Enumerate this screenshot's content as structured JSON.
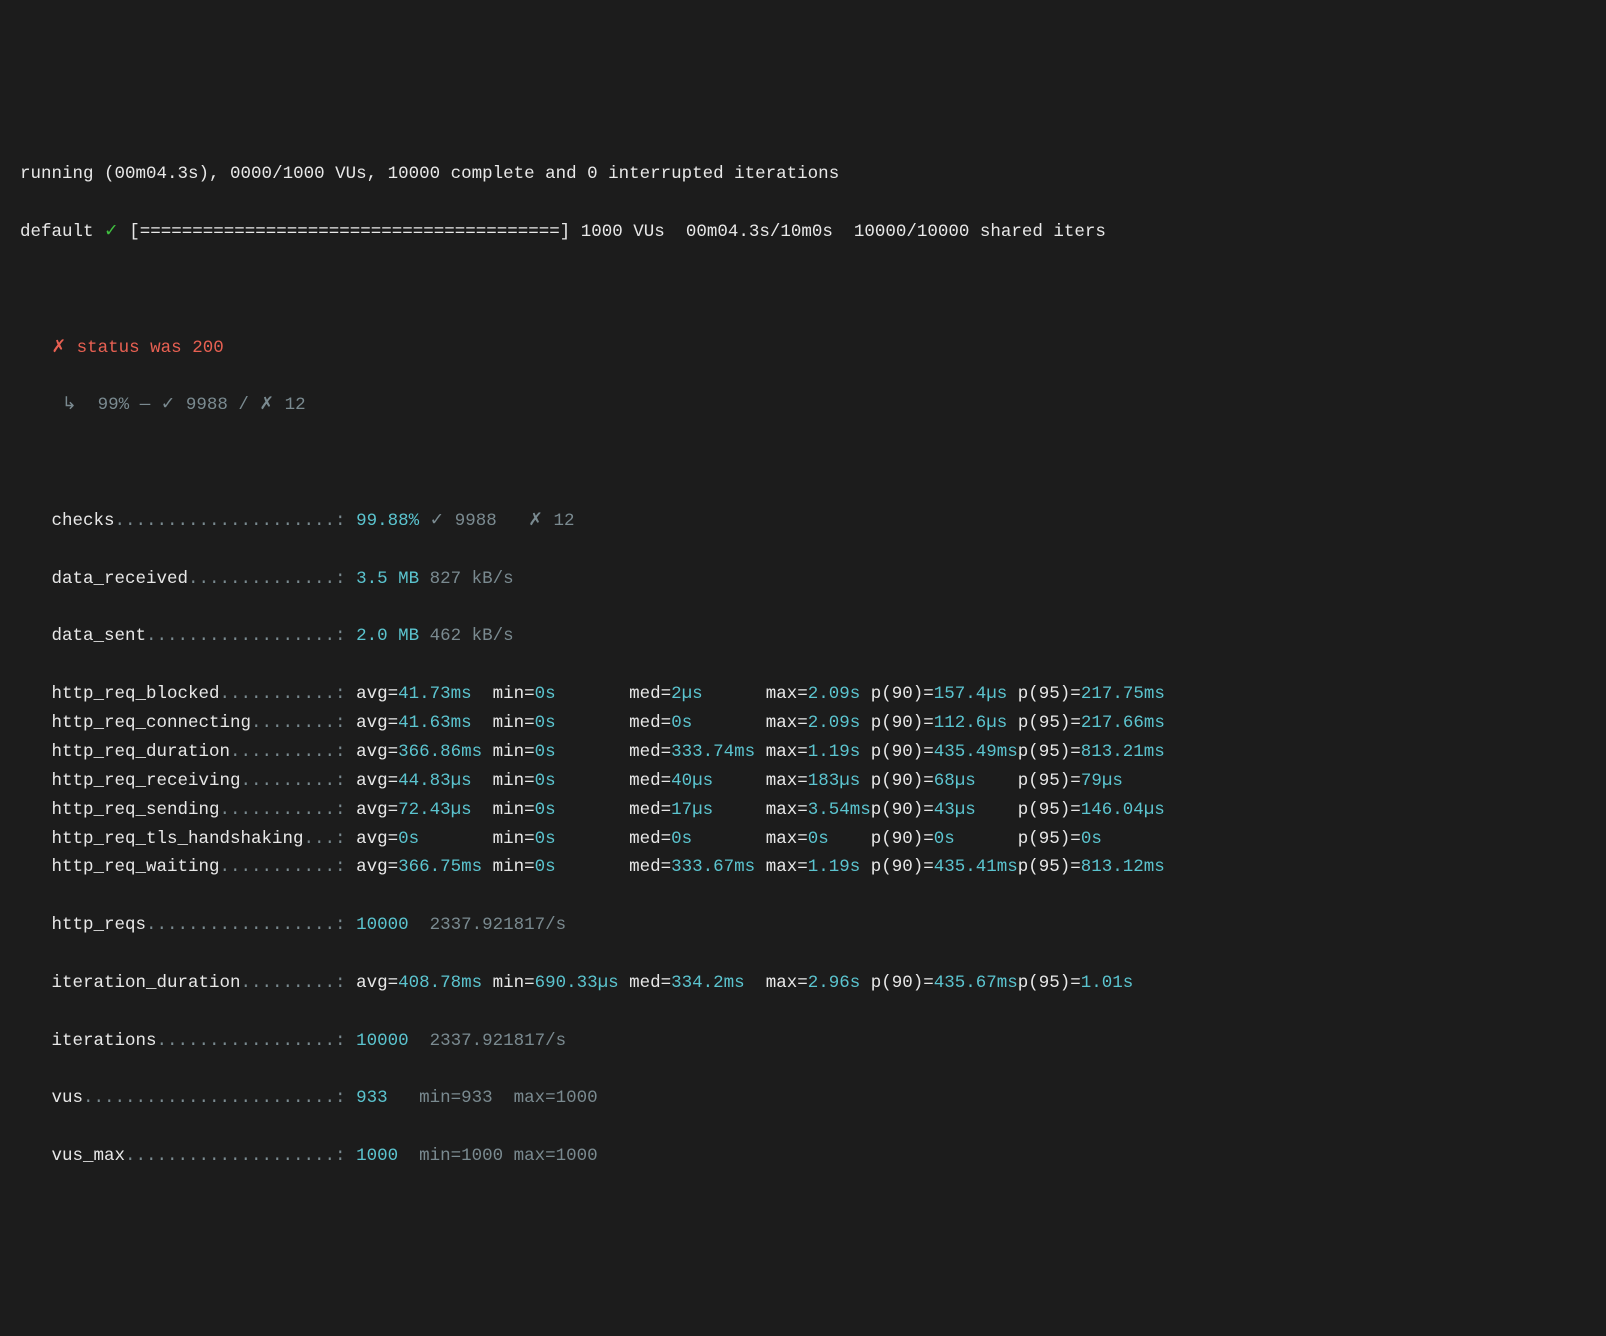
{
  "running_line": {
    "prefix": "running (",
    "elapsed": "00m04.3s",
    "mid": "), ",
    "active_vus": "0000",
    "slash": "/",
    "total_vus": "1000",
    "vus_label": " VUs, ",
    "complete": "10000",
    "tail": " complete and 0 interrupted iterations"
  },
  "scenario_line": {
    "name": "default",
    "check": " ✓",
    "bar_open": " [",
    "bar_fill": "========================================",
    "bar_close": "] ",
    "vus": "1000 VUs",
    "sp1": "  ",
    "time": "00m04.3s/10m0s",
    "sp2": "  ",
    "iters": "10000/10000 shared iters"
  },
  "check_header": {
    "cross": "✗ ",
    "text": "status was 200"
  },
  "check_detail": {
    "arrow": " ↳  ",
    "pct": "99%",
    "dash": " — ",
    "tick": "✓ ",
    "pass": "9988",
    "sep": " / ",
    "cross": "✗ ",
    "fail": "12"
  },
  "checks_line": {
    "label": "checks",
    "dots": ".....................: ",
    "pct": "99.88%",
    "tick": " ✓ ",
    "pass": "9988",
    "cross": "   ✗ ",
    "fail": "12"
  },
  "data_received": {
    "label": "data_received",
    "dots": "..............: ",
    "v1": "3.5 MB",
    "v2": " 827 kB/s"
  },
  "data_sent": {
    "label": "data_sent",
    "dots": "..................: ",
    "v1": "2.0 MB",
    "v2": " 462 kB/s"
  },
  "trend_rows": [
    {
      "label": "http_req_blocked",
      "dots": "...........: ",
      "avg": "41.73ms",
      "min": "0s",
      "med": "2µs",
      "max": "2.09s",
      "p90": "157.4µs",
      "p95": "217.75ms"
    },
    {
      "label": "http_req_connecting",
      "dots": "........: ",
      "avg": "41.63ms",
      "min": "0s",
      "med": "0s",
      "max": "2.09s",
      "p90": "112.6µs",
      "p95": "217.66ms"
    },
    {
      "label": "http_req_duration",
      "dots": "..........: ",
      "avg": "366.86ms",
      "min": "0s",
      "med": "333.74ms",
      "max": "1.19s",
      "p90": "435.49ms",
      "p95": "813.21ms"
    },
    {
      "label": "http_req_receiving",
      "dots": ".........: ",
      "avg": "44.83µs",
      "min": "0s",
      "med": "40µs",
      "max": "183µs",
      "p90": "68µs",
      "p95": "79µs"
    },
    {
      "label": "http_req_sending",
      "dots": "...........: ",
      "avg": "72.43µs",
      "min": "0s",
      "med": "17µs",
      "max": "3.54ms",
      "p90": "43µs",
      "p95": "146.04µs"
    },
    {
      "label": "http_req_tls_handshaking",
      "dots": "...: ",
      "avg": "0s",
      "min": "0s",
      "med": "0s",
      "max": "0s",
      "p90": "0s",
      "p95": "0s"
    },
    {
      "label": "http_req_waiting",
      "dots": "...........: ",
      "avg": "366.75ms",
      "min": "0s",
      "med": "333.67ms",
      "max": "1.19s",
      "p90": "435.41ms",
      "p95": "813.12ms"
    }
  ],
  "http_reqs": {
    "label": "http_reqs",
    "dots": "..................: ",
    "v1": "10000",
    "v2": "  2337.921817/s"
  },
  "iter_dur": {
    "label": "iteration_duration",
    "dots": ".........: ",
    "avg": "408.78ms",
    "min": "690.33µs",
    "med": "334.2ms",
    "max": "2.96s",
    "p90": "435.67ms",
    "p95": "1.01s"
  },
  "iterations": {
    "label": "iterations",
    "dots": ".................: ",
    "v1": "10000",
    "v2": "  2337.921817/s"
  },
  "vus": {
    "label": "vus",
    "dots": "........................: ",
    "v1": "933",
    "extra": "   min=933  max=1000"
  },
  "vus_max": {
    "label": "vus_max",
    "dots": "....................: ",
    "v1": "1000",
    "extra": "  min=1000 max=1000"
  },
  "labels": {
    "avg": "avg=",
    "min": "min=",
    "med": "med=",
    "max": "max=",
    "p90": "p(90)=",
    "p95": "p(95)="
  }
}
